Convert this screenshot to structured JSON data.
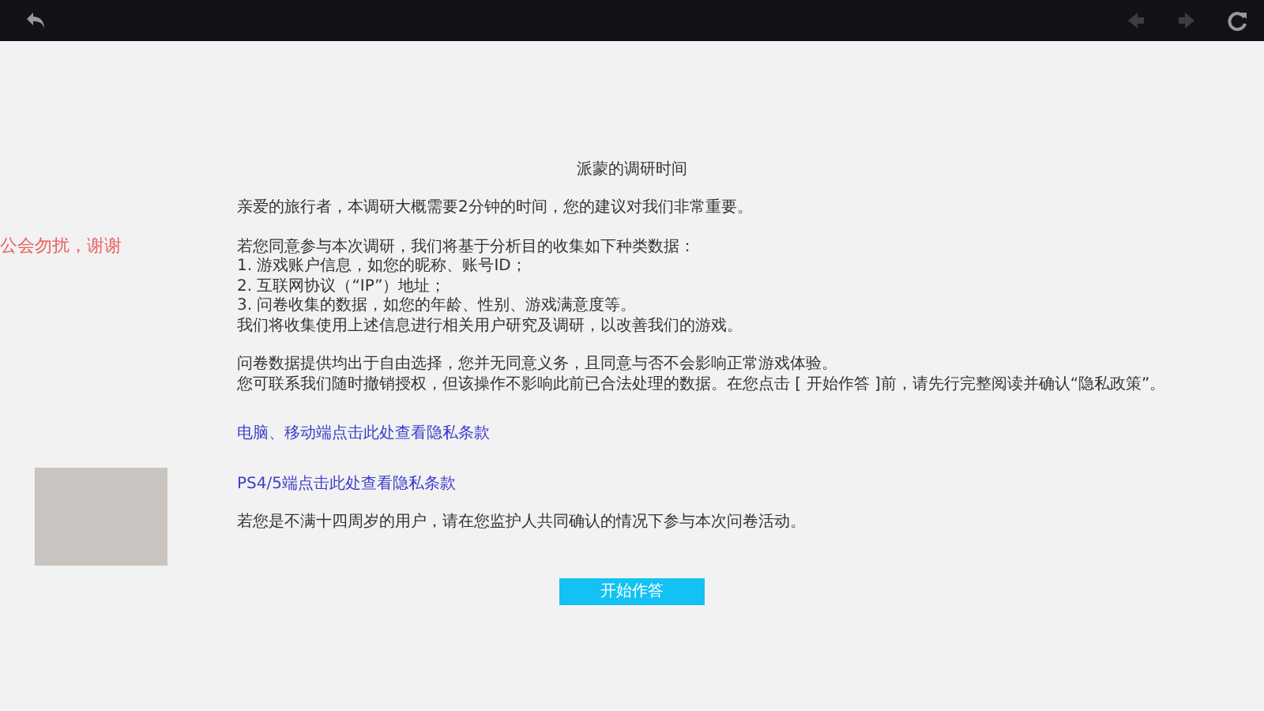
{
  "toolbar": {
    "buttons": [
      {
        "kind": "back",
        "disabled": false
      },
      {
        "kind": "prev",
        "disabled": true
      },
      {
        "kind": "next",
        "disabled": true
      },
      {
        "kind": "refresh",
        "disabled": false
      }
    ]
  },
  "survey": {
    "title": "派蒙的调研时间",
    "paragraphs": [
      [
        "亲爱的旅行者，本调研大概需要2分钟的时间，您的建议对我们非常重要。"
      ],
      [
        "若您同意参与本次调研，我们将基于分析目的收集如下种类数据：",
        "1. 游戏账户信息，如您的昵称、账号ID；",
        "2. 互联网协议（“IP”）地址；",
        "3. 问卷收集的数据，如您的年龄、性别、游戏满意度等。",
        "我们将收集使用上述信息进行相关用户研究及调研，以改善我们的游戏。"
      ],
      [
        "问卷数据提供均出于自由选择，您并无同意义务，且同意与否不会影响正常游戏体验。",
        "您可联系我们随时撤销授权，但该操作不影响此前已合法处理的数据。在您点击 [ 开始作答 ]前，请先行完整阅读并确认“隐私政策”。"
      ]
    ],
    "links": [
      "电脑、移动端点击此处查看隐私条款",
      "PS4/5端点击此处查看隐私条款"
    ],
    "notice": "若您是不满十四周岁的用户，请在您监护人共同确认的情况下参与本次问卷活动。",
    "start_button": "开始作答"
  },
  "overlay": {
    "caption": "公会勿扰，谢谢"
  }
}
